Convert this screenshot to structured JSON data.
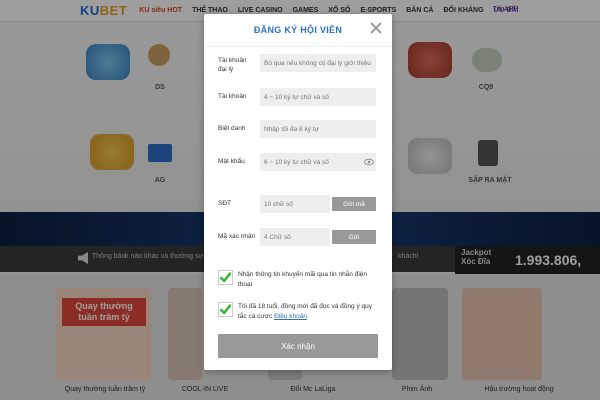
{
  "header": {
    "logo_main": "KU",
    "logo_accent": "BET",
    "nav": [
      "KU siêu HOT",
      "THỂ THAO",
      "LIVE CASINO",
      "GAMES",
      "XỔ SỐ",
      "E-SPORTS",
      "BẮN CÁ",
      "ĐỔI KHÁNG",
      "ƯU ĐÃI"
    ],
    "download": "Tải APP"
  },
  "games": {
    "labels": [
      "DS",
      "CQ9",
      "AG",
      "SẬP RA MẶT"
    ]
  },
  "notice": {
    "label": "Thông báo",
    "text": "k nào khác và thưởng sự",
    "text_right": "khách!"
  },
  "jackpot": {
    "title_line1": "Jackpot",
    "title_line2": "Xóc Đĩa",
    "value": "1.993.806,"
  },
  "promos": {
    "tile1_text": "Quay thưởng tuần trăm tỷ",
    "labels": [
      "Quay thưởng tuần trăm tỷ",
      "COOL-IN LIVE",
      "Đổi Mc LaLiga",
      "Phim Ảnh",
      "Hậu trường hoạt động"
    ]
  },
  "modal": {
    "title": "ĐĂNG KÝ HỘI VIÊN",
    "fields": {
      "agent": {
        "label": "Tài khoản đại lý",
        "placeholder": "Bỏ qua nếu không có đại lý giới thiệu"
      },
      "account": {
        "label": "Tài khoản",
        "placeholder": "4 ~ 10 ký tự chữ và số"
      },
      "nickname": {
        "label": "Biệt danh",
        "placeholder": "Nhập tối đa 8 ký tự"
      },
      "password": {
        "label": "Mật khẩu",
        "placeholder": "6 ~ 10 ký tự chữ và số"
      },
      "phone": {
        "label": "SĐT",
        "placeholder": "10 chữ số",
        "button": "Gửi mã"
      },
      "captcha": {
        "label": "Mã xác nhận",
        "placeholder": "4 Chữ số",
        "button": "Gửi"
      }
    },
    "checkbox1": "Nhận thông tin khuyến mãi qua tin nhắn điện thoại",
    "checkbox2_prefix": "Tôi đã 18 tuổi, đồng mới đã đọc và đồng ý quy tắc cá cược",
    "checkbox2_link": "Điều khoản",
    "submit": "Xác nhận"
  },
  "colors": {
    "title_blue": "#2b6fc7",
    "check_green": "#2fb830",
    "button_gray": "#999999"
  }
}
